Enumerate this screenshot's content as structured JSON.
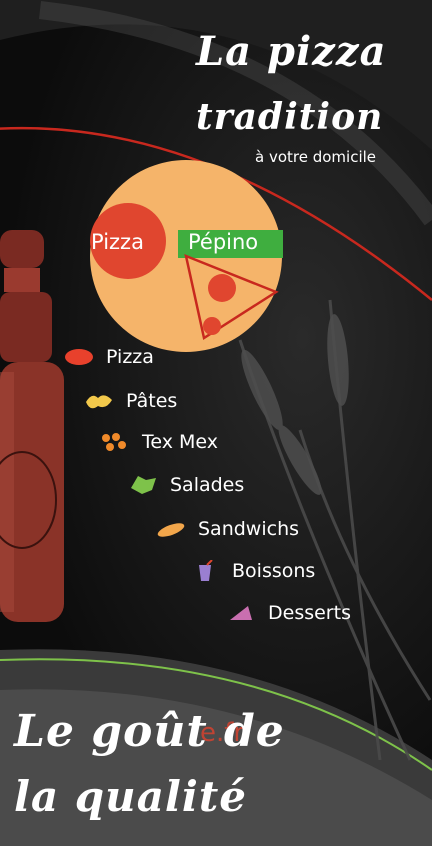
{
  "header": {
    "title_line1": "La pizza",
    "title_line2": "tradition",
    "tagline": "à votre domicile"
  },
  "brand": {
    "name_part1": "Pizza",
    "name_part2": "Pépino"
  },
  "menu": {
    "items": [
      {
        "label": "Pizza",
        "icon": "pizza-icon",
        "color": "#e8412c"
      },
      {
        "label": "Pâtes",
        "icon": "pasta-icon",
        "color": "#f2c84b"
      },
      {
        "label": "Tex Mex",
        "icon": "texmex-icon",
        "color": "#f08a2a"
      },
      {
        "label": "Salades",
        "icon": "salad-icon",
        "color": "#7ec24a"
      },
      {
        "label": "Sandwichs",
        "icon": "sandwich-icon",
        "color": "#f2a64b"
      },
      {
        "label": "Boissons",
        "icon": "drink-icon",
        "color": "#9a7fd1"
      },
      {
        "label": "Desserts",
        "icon": "dessert-icon",
        "color": "#c96fb0"
      }
    ]
  },
  "footer": {
    "line1": "Le goût de",
    "line2": "la qualité"
  },
  "watermark": "e.fr",
  "colors": {
    "pizza_base": "#f5b46a",
    "tomato": "#e0462f",
    "green_band": "#3fae3f",
    "accent_red": "#c8281e"
  }
}
